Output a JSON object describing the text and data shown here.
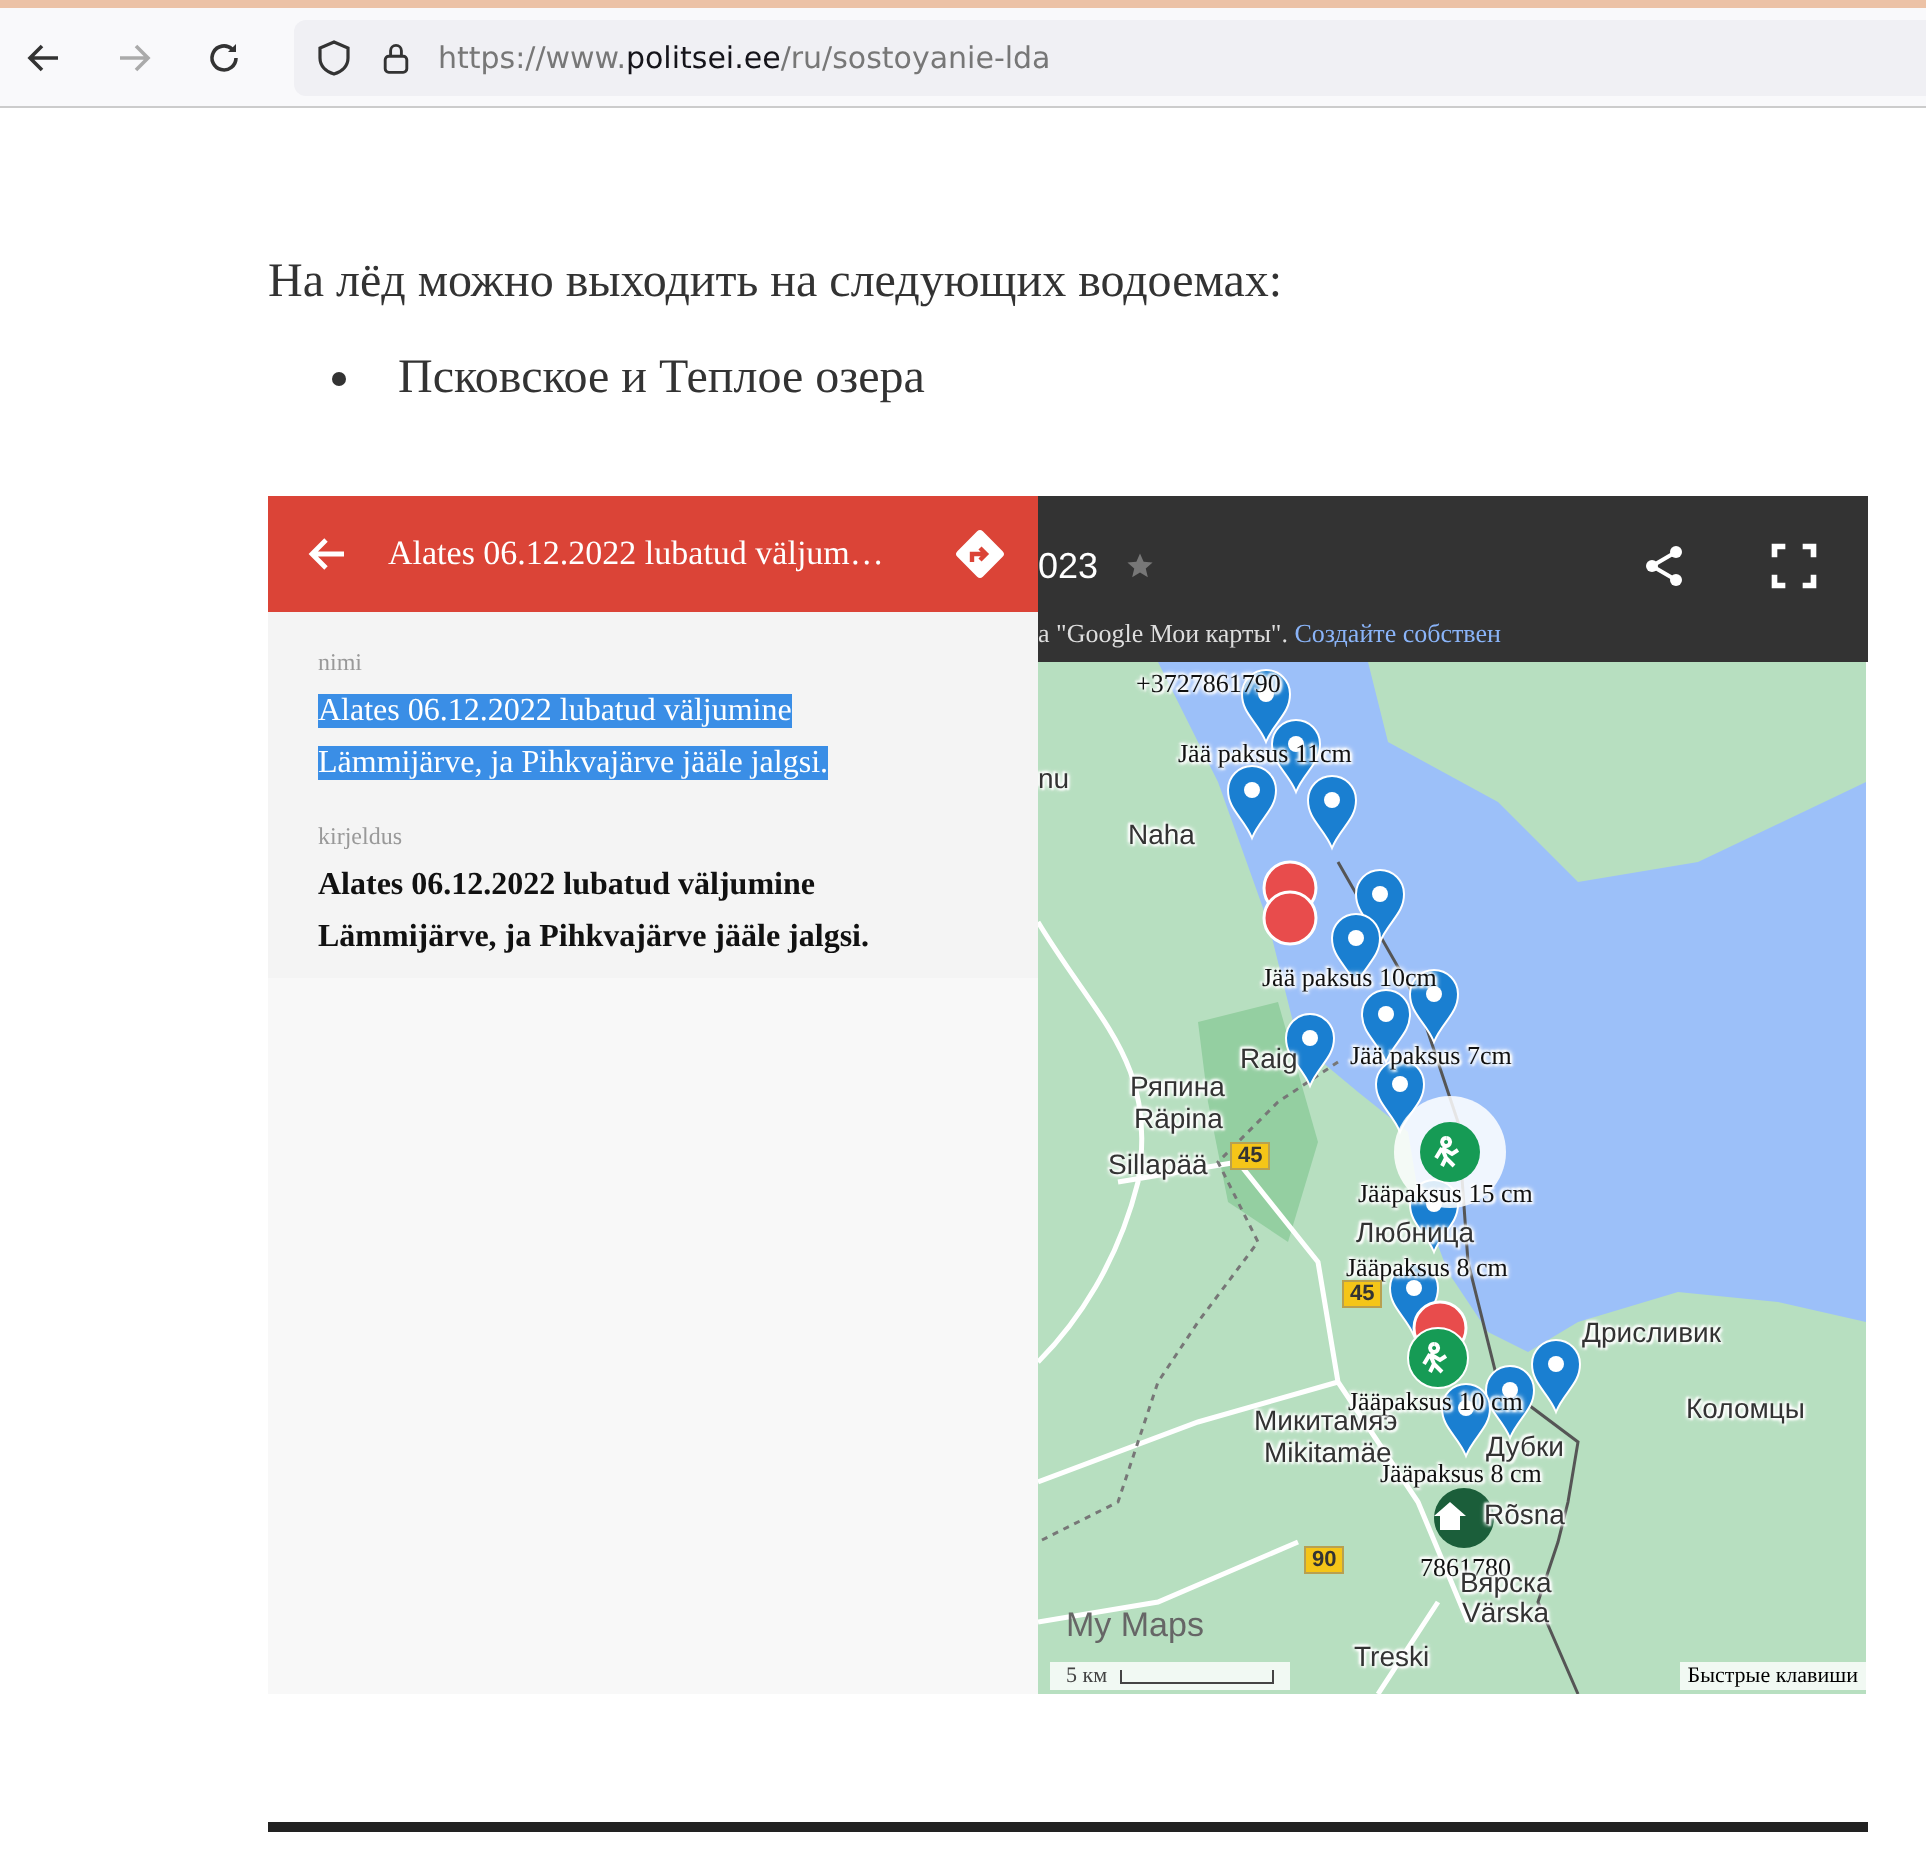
{
  "browser": {
    "url": {
      "prefix": "https://www.",
      "domain": "politsei.ee",
      "path": "/ru/sostoyanie-lda"
    }
  },
  "article": {
    "paragraph": "На лёд можно выходить на следующих водоемах:",
    "bullets": [
      "Псковское и Теплое озера"
    ]
  },
  "map_embed": {
    "map_title": "023",
    "subtitle": "а \"Google Мои карты\".",
    "subtitle_link": "Создайте собствен",
    "panel": {
      "title": "Alates 06.12.2022 lubatud väljum…",
      "fields": [
        {
          "label": "nimi",
          "value": "Alates 06.12.2022 lubatud väljumine Lämmijärve, ja Pihkvajärve jääle jalgsi.",
          "highlighted": true
        },
        {
          "label": "kirjeldus",
          "value": "Alates 06.12.2022 lubatud väljumine Lämmijärve, ja Pihkvajärve jääle jalgsi.",
          "highlighted": false
        }
      ]
    },
    "map_labels": [
      {
        "kind": "marker",
        "text": "+3727861790"
      },
      {
        "kind": "marker",
        "text": "Jää paksus 11cm"
      },
      {
        "kind": "place",
        "text": "nu"
      },
      {
        "kind": "place",
        "text": "Naha"
      },
      {
        "kind": "marker",
        "text": "Jää paksus 10cm"
      },
      {
        "kind": "place",
        "text": "Raig"
      },
      {
        "kind": "marker",
        "text": "Jää paksus 7cm"
      },
      {
        "kind": "place",
        "text": "Ряпина"
      },
      {
        "kind": "place",
        "text": "Räpina"
      },
      {
        "kind": "place",
        "text": "Sillapää"
      },
      {
        "kind": "road",
        "text": "45"
      },
      {
        "kind": "marker",
        "text": "Jääpaksus 15 cm"
      },
      {
        "kind": "place",
        "text": "Любница"
      },
      {
        "kind": "marker",
        "text": "Jääpaksus 8 cm"
      },
      {
        "kind": "road",
        "text": "45"
      },
      {
        "kind": "place",
        "text": "Дрисливик"
      },
      {
        "kind": "place",
        "text": "Микитамяэ"
      },
      {
        "kind": "marker",
        "text": "Jääpaksus 10 cm"
      },
      {
        "kind": "place",
        "text": "Коломцы"
      },
      {
        "kind": "place",
        "text": "Mikitamäe"
      },
      {
        "kind": "place",
        "text": "Дубки"
      },
      {
        "kind": "marker",
        "text": "Jääpaksus 8 cm"
      },
      {
        "kind": "place",
        "text": "Rõsna"
      },
      {
        "kind": "road",
        "text": "90"
      },
      {
        "kind": "marker",
        "text": "7861780"
      },
      {
        "kind": "place",
        "text": "Вярска"
      },
      {
        "kind": "place",
        "text": "Värska"
      },
      {
        "kind": "place",
        "text": "Treski"
      }
    ],
    "logo": "My Maps",
    "scale": "5 км",
    "shortcuts": "Быстрые клавиши"
  }
}
